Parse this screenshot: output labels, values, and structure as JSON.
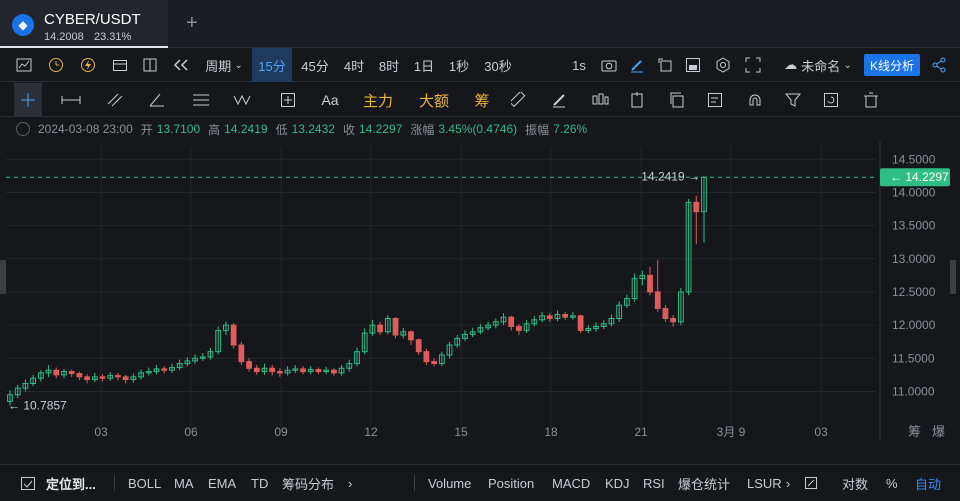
{
  "tab": {
    "title": "CYBER/USDT",
    "price": "14.2008",
    "change": "23.31%",
    "add": "+"
  },
  "toolbar1": {
    "period_label": "周期",
    "intervals": [
      "15分",
      "45分",
      "4时",
      "8时",
      "1日",
      "1秒",
      "30秒"
    ],
    "active_interval": "15分",
    "one_s": "1s",
    "unnamed": "未命名",
    "kline_btn": "K线分析"
  },
  "toolbar2": {
    "aa": "Aa",
    "main": "主力",
    "big": "大额",
    "chips": "筹"
  },
  "info": {
    "datetime": "2024-03-08 23:00",
    "open_label": "开",
    "open": "13.7100",
    "high_label": "高",
    "high": "14.2419",
    "low_label": "低",
    "low": "13.2432",
    "close_label": "收",
    "close": "14.2297",
    "change_label": "涨幅",
    "change": "3.45%(0.4746)",
    "amp_label": "振幅",
    "amp": "7.26%"
  },
  "colors": {
    "up": "#2ebd85",
    "down": "#e05b5b",
    "accent": "#1a73e8",
    "bg": "#15171b"
  },
  "chart_data": {
    "type": "candlestick",
    "y_ticks": [
      "14.5000",
      "14.0000",
      "13.5000",
      "13.0000",
      "12.5000",
      "12.0000",
      "11.5000",
      "11.0000"
    ],
    "ylim": [
      10.6,
      14.7
    ],
    "x_ticks": [
      "03",
      "06",
      "09",
      "12",
      "15",
      "18",
      "21",
      "3月 9",
      "03"
    ],
    "x_tick_positions": [
      3,
      6,
      9,
      12,
      15,
      18,
      21,
      24,
      27
    ],
    "high_label": "14.2419 →",
    "low_label": "← 10.7857",
    "current_price": "14.2297",
    "current_value": 14.2297,
    "high_value": 14.2419,
    "low_value": 10.7857,
    "candles": [
      [
        10.85,
        10.95,
        11.02,
        10.79
      ],
      [
        10.95,
        11.05,
        11.1,
        10.9
      ],
      [
        11.05,
        11.12,
        11.18,
        11.0
      ],
      [
        11.12,
        11.2,
        11.25,
        11.08
      ],
      [
        11.2,
        11.28,
        11.32,
        11.15
      ],
      [
        11.28,
        11.32,
        11.4,
        11.22
      ],
      [
        11.32,
        11.25,
        11.36,
        11.2
      ],
      [
        11.25,
        11.3,
        11.34,
        11.2
      ],
      [
        11.3,
        11.27,
        11.33,
        11.22
      ],
      [
        11.27,
        11.22,
        11.3,
        11.17
      ],
      [
        11.22,
        11.18,
        11.26,
        11.12
      ],
      [
        11.18,
        11.22,
        11.28,
        11.14
      ],
      [
        11.22,
        11.2,
        11.26,
        11.15
      ],
      [
        11.2,
        11.24,
        11.29,
        11.16
      ],
      [
        11.24,
        11.22,
        11.28,
        11.17
      ],
      [
        11.22,
        11.18,
        11.25,
        11.12
      ],
      [
        11.18,
        11.22,
        11.27,
        11.13
      ],
      [
        11.22,
        11.28,
        11.33,
        11.18
      ],
      [
        11.28,
        11.3,
        11.36,
        11.24
      ],
      [
        11.3,
        11.34,
        11.4,
        11.26
      ],
      [
        11.34,
        11.32,
        11.38,
        11.27
      ],
      [
        11.32,
        11.36,
        11.42,
        11.28
      ],
      [
        11.36,
        11.42,
        11.48,
        11.32
      ],
      [
        11.42,
        11.46,
        11.52,
        11.38
      ],
      [
        11.46,
        11.5,
        11.56,
        11.42
      ],
      [
        11.5,
        11.52,
        11.58,
        11.46
      ],
      [
        11.52,
        11.6,
        11.66,
        11.48
      ],
      [
        11.6,
        11.92,
        11.98,
        11.56
      ],
      [
        11.92,
        12.0,
        12.05,
        11.85
      ],
      [
        12.0,
        11.7,
        12.03,
        11.65
      ],
      [
        11.7,
        11.45,
        11.75,
        11.4
      ],
      [
        11.45,
        11.35,
        11.5,
        11.3
      ],
      [
        11.35,
        11.3,
        11.4,
        11.25
      ],
      [
        11.3,
        11.35,
        11.42,
        11.25
      ],
      [
        11.35,
        11.3,
        11.4,
        11.24
      ],
      [
        11.3,
        11.28,
        11.35,
        11.22
      ],
      [
        11.28,
        11.32,
        11.38,
        11.24
      ],
      [
        11.32,
        11.34,
        11.4,
        11.28
      ],
      [
        11.34,
        11.3,
        11.38,
        11.26
      ],
      [
        11.3,
        11.33,
        11.38,
        11.26
      ],
      [
        11.33,
        11.3,
        11.36,
        11.26
      ],
      [
        11.3,
        11.32,
        11.37,
        11.26
      ],
      [
        11.32,
        11.28,
        11.35,
        11.24
      ],
      [
        11.28,
        11.35,
        11.4,
        11.24
      ],
      [
        11.35,
        11.42,
        11.48,
        11.3
      ],
      [
        11.42,
        11.6,
        11.66,
        11.38
      ],
      [
        11.6,
        11.88,
        11.95,
        11.56
      ],
      [
        11.88,
        12.0,
        12.08,
        11.84
      ],
      [
        12.0,
        11.9,
        12.05,
        11.85
      ],
      [
        11.9,
        12.1,
        12.15,
        11.86
      ],
      [
        12.1,
        11.85,
        12.12,
        11.8
      ],
      [
        11.85,
        11.9,
        11.96,
        11.8
      ],
      [
        11.9,
        11.78,
        11.92,
        11.7
      ],
      [
        11.78,
        11.6,
        11.8,
        11.55
      ],
      [
        11.6,
        11.45,
        11.64,
        11.4
      ],
      [
        11.45,
        11.42,
        11.5,
        11.38
      ],
      [
        11.42,
        11.55,
        11.6,
        11.38
      ],
      [
        11.55,
        11.7,
        11.75,
        11.5
      ],
      [
        11.7,
        11.8,
        11.85,
        11.66
      ],
      [
        11.8,
        11.86,
        11.92,
        11.76
      ],
      [
        11.86,
        11.9,
        11.96,
        11.82
      ],
      [
        11.9,
        11.96,
        12.02,
        11.86
      ],
      [
        11.96,
        12.0,
        12.05,
        11.92
      ],
      [
        12.0,
        12.05,
        12.1,
        11.95
      ],
      [
        12.05,
        12.12,
        12.18,
        12.0
      ],
      [
        12.12,
        11.98,
        12.14,
        11.92
      ],
      [
        11.98,
        11.92,
        12.02,
        11.85
      ],
      [
        11.92,
        12.02,
        12.08,
        11.88
      ],
      [
        12.02,
        12.08,
        12.14,
        11.98
      ],
      [
        12.08,
        12.14,
        12.2,
        12.04
      ],
      [
        12.14,
        12.1,
        12.18,
        12.05
      ],
      [
        12.1,
        12.16,
        12.22,
        12.06
      ],
      [
        12.16,
        12.12,
        12.2,
        12.08
      ],
      [
        12.12,
        12.14,
        12.2,
        12.08
      ],
      [
        12.14,
        11.92,
        12.16,
        11.88
      ],
      [
        11.92,
        11.95,
        12.0,
        11.88
      ],
      [
        11.95,
        11.98,
        12.04,
        11.9
      ],
      [
        11.98,
        12.02,
        12.08,
        11.94
      ],
      [
        12.02,
        12.1,
        12.16,
        11.98
      ],
      [
        12.1,
        12.3,
        12.36,
        12.05
      ],
      [
        12.3,
        12.4,
        12.46,
        12.26
      ],
      [
        12.4,
        12.7,
        12.78,
        12.35
      ],
      [
        12.7,
        12.75,
        12.82,
        12.6
      ],
      [
        12.75,
        12.5,
        12.88,
        12.45
      ],
      [
        12.5,
        12.25,
        12.98,
        12.2
      ],
      [
        12.25,
        12.1,
        12.3,
        12.05
      ],
      [
        12.1,
        12.05,
        12.15,
        11.98
      ],
      [
        12.05,
        12.5,
        12.56,
        12.0
      ],
      [
        12.5,
        13.85,
        13.9,
        12.45
      ],
      [
        13.85,
        13.71,
        13.95,
        13.22
      ],
      [
        13.71,
        14.2297,
        14.2419,
        13.2432
      ]
    ]
  },
  "bottom": {
    "locate": "定位到...",
    "items": [
      "BOLL",
      "MA",
      "EMA",
      "TD",
      "筹码分布",
      "Volume",
      "Position",
      "MACD",
      "KDJ",
      "RSI",
      "爆仓统计",
      "LSUR"
    ],
    "log": "对数",
    "pct": "%",
    "auto": "自动",
    "right_top": [
      "筹",
      "爆"
    ]
  }
}
